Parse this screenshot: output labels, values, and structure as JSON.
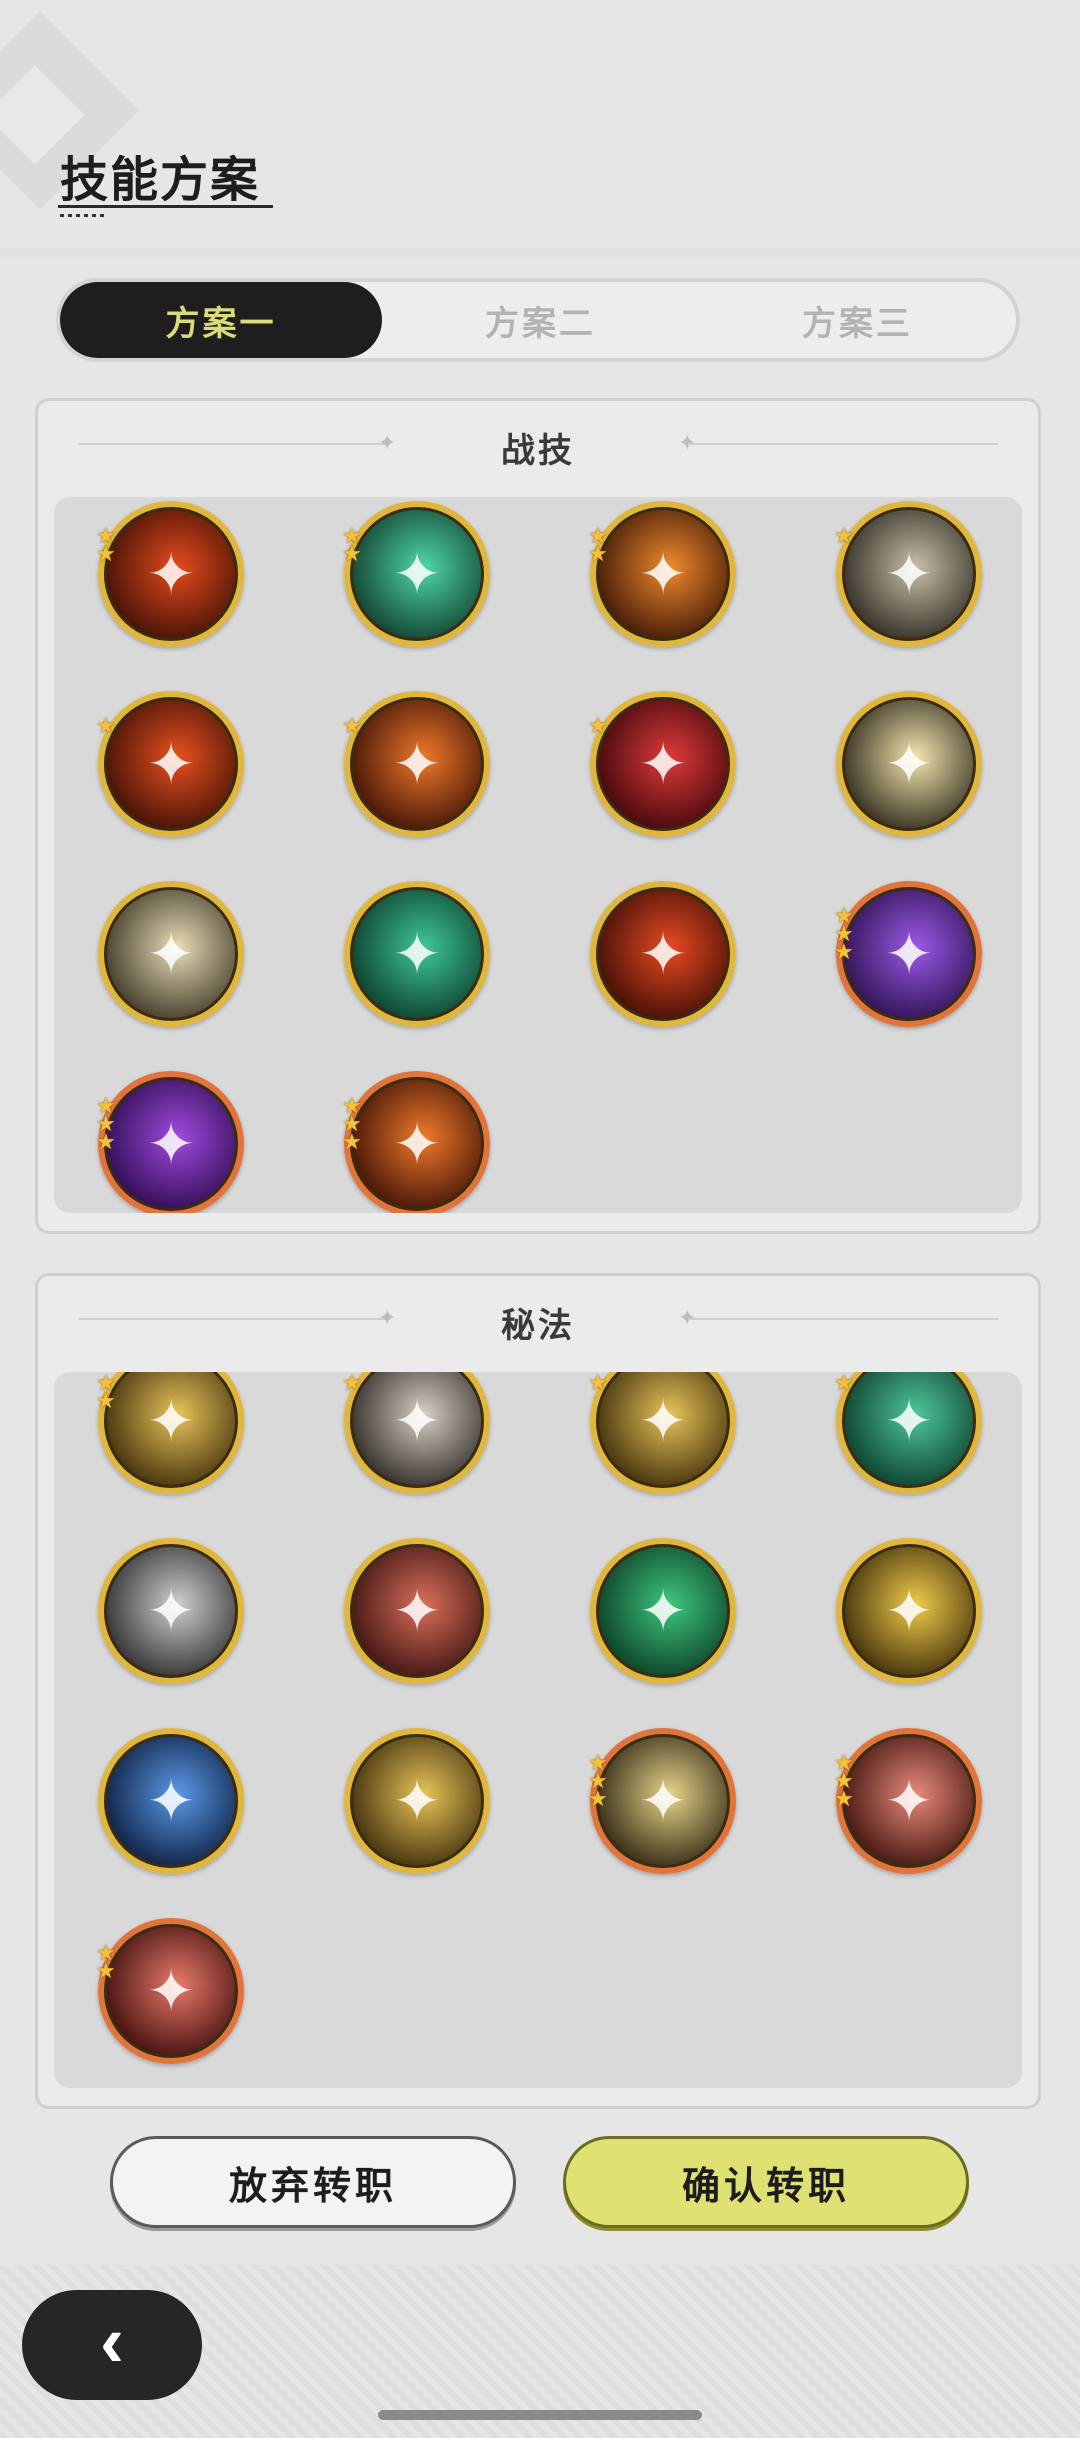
{
  "header": {
    "title": "技能方案"
  },
  "tabs": [
    {
      "label": "方案一",
      "active": true
    },
    {
      "label": "方案二",
      "active": false
    },
    {
      "label": "方案三",
      "active": false
    }
  ],
  "battle": {
    "title": "战技",
    "skills": [
      {
        "icon": "fire-slash-skill-icon",
        "rarity": 2,
        "frame": "gold",
        "colors": [
          "#3a0f05",
          "#e64a1c"
        ]
      },
      {
        "icon": "jade-sword-skill-icon",
        "rarity": 2,
        "frame": "gold",
        "colors": [
          "#0f3a2a",
          "#4ed8a6"
        ]
      },
      {
        "icon": "flame-burst-skill-icon",
        "rarity": 2,
        "frame": "gold",
        "colors": [
          "#3a1405",
          "#f08a2c"
        ]
      },
      {
        "icon": "whirlwind-skill-icon",
        "rarity": 1,
        "frame": "gold",
        "colors": [
          "#2b2820",
          "#c9bfa8"
        ]
      },
      {
        "icon": "fire-swirl-skill-icon",
        "rarity": 1,
        "frame": "gold",
        "colors": [
          "#3a0f05",
          "#e8501e"
        ]
      },
      {
        "icon": "fire-sigil-skill-icon",
        "rarity": 1,
        "frame": "gold",
        "colors": [
          "#3a1005",
          "#f0782a"
        ]
      },
      {
        "icon": "crimson-hero-skill-icon",
        "rarity": 1,
        "frame": "gold",
        "colors": [
          "#3a050a",
          "#e03a3a"
        ]
      },
      {
        "icon": "light-burst-skill-icon",
        "rarity": 0,
        "frame": "gold",
        "colors": [
          "#2a2518",
          "#f4e6b0"
        ]
      },
      {
        "icon": "sand-vortex-skill-icon",
        "rarity": 0,
        "frame": "gold",
        "colors": [
          "#3a3322",
          "#e8dcb8"
        ]
      },
      {
        "icon": "emerald-vortex-skill-icon",
        "rarity": 0,
        "frame": "gold",
        "colors": [
          "#0a3a28",
          "#3ec79a"
        ]
      },
      {
        "icon": "fire-strike-skill-icon",
        "rarity": 0,
        "frame": "gold",
        "colors": [
          "#3a0c05",
          "#e84a22"
        ]
      },
      {
        "icon": "violet-rose-skill-icon",
        "rarity": 3,
        "frame": "orange",
        "colors": [
          "#2a0f4a",
          "#9a5ae8"
        ]
      },
      {
        "icon": "shadow-demon-skill-icon",
        "rarity": 3,
        "frame": "orange",
        "colors": [
          "#2a0a4a",
          "#a04ae0"
        ]
      },
      {
        "icon": "inferno-figure-skill-icon",
        "rarity": 3,
        "frame": "orange",
        "colors": [
          "#3a0f05",
          "#f07a2a"
        ]
      }
    ]
  },
  "secret": {
    "title": "秘法",
    "skills": [
      {
        "icon": "golden-heal-skill-icon",
        "rarity": 2,
        "frame": "gold",
        "colors": [
          "#3a2a08",
          "#e8c45a"
        ]
      },
      {
        "icon": "stone-shard-skill-icon",
        "rarity": 1,
        "frame": "gold",
        "colors": [
          "#2a2622",
          "#d8cfc4"
        ]
      },
      {
        "icon": "golden-target-skill-icon",
        "rarity": 1,
        "frame": "gold",
        "colors": [
          "#3a2a08",
          "#e8c45a"
        ]
      },
      {
        "icon": "green-heart-skill-icon",
        "rarity": 1,
        "frame": "gold",
        "colors": [
          "#0a3a28",
          "#4ec79a"
        ]
      },
      {
        "icon": "silver-shield-skill-icon",
        "rarity": 0,
        "frame": "gold",
        "colors": [
          "#2a2a2a",
          "#cfcfcf"
        ]
      },
      {
        "icon": "crimson-armor-skill-icon",
        "rarity": 0,
        "frame": "gold",
        "colors": [
          "#3a1010",
          "#d8705a"
        ]
      },
      {
        "icon": "jade-crystal-skill-icon",
        "rarity": 0,
        "frame": "gold",
        "colors": [
          "#0a3a22",
          "#3ec780"
        ]
      },
      {
        "icon": "golden-spirit-skill-icon",
        "rarity": 0,
        "frame": "gold",
        "colors": [
          "#3a2a08",
          "#f0cc4a"
        ]
      },
      {
        "icon": "azure-emblem-skill-icon",
        "rarity": 0,
        "frame": "gold",
        "colors": [
          "#0a1a3a",
          "#5a9ae8"
        ]
      },
      {
        "icon": "golden-figure-skill-icon",
        "rarity": 0,
        "frame": "gold",
        "colors": [
          "#3a2a08",
          "#e8c45a"
        ]
      },
      {
        "icon": "golden-eye-skill-icon",
        "rarity": 3,
        "frame": "orange",
        "colors": [
          "#2a2210",
          "#e8d48a"
        ]
      },
      {
        "icon": "rose-bloom-skill-icon",
        "rarity": 3,
        "frame": "orange",
        "colors": [
          "#3a100a",
          "#e88a7a"
        ]
      },
      {
        "icon": "crimson-crescent-skill-icon",
        "rarity": 2,
        "frame": "orange",
        "colors": [
          "#3a0a0a",
          "#e87a6a"
        ]
      }
    ]
  },
  "buttons": {
    "cancel": "放弃转职",
    "confirm": "确认转职"
  },
  "footer": {
    "back_icon": "‹"
  }
}
